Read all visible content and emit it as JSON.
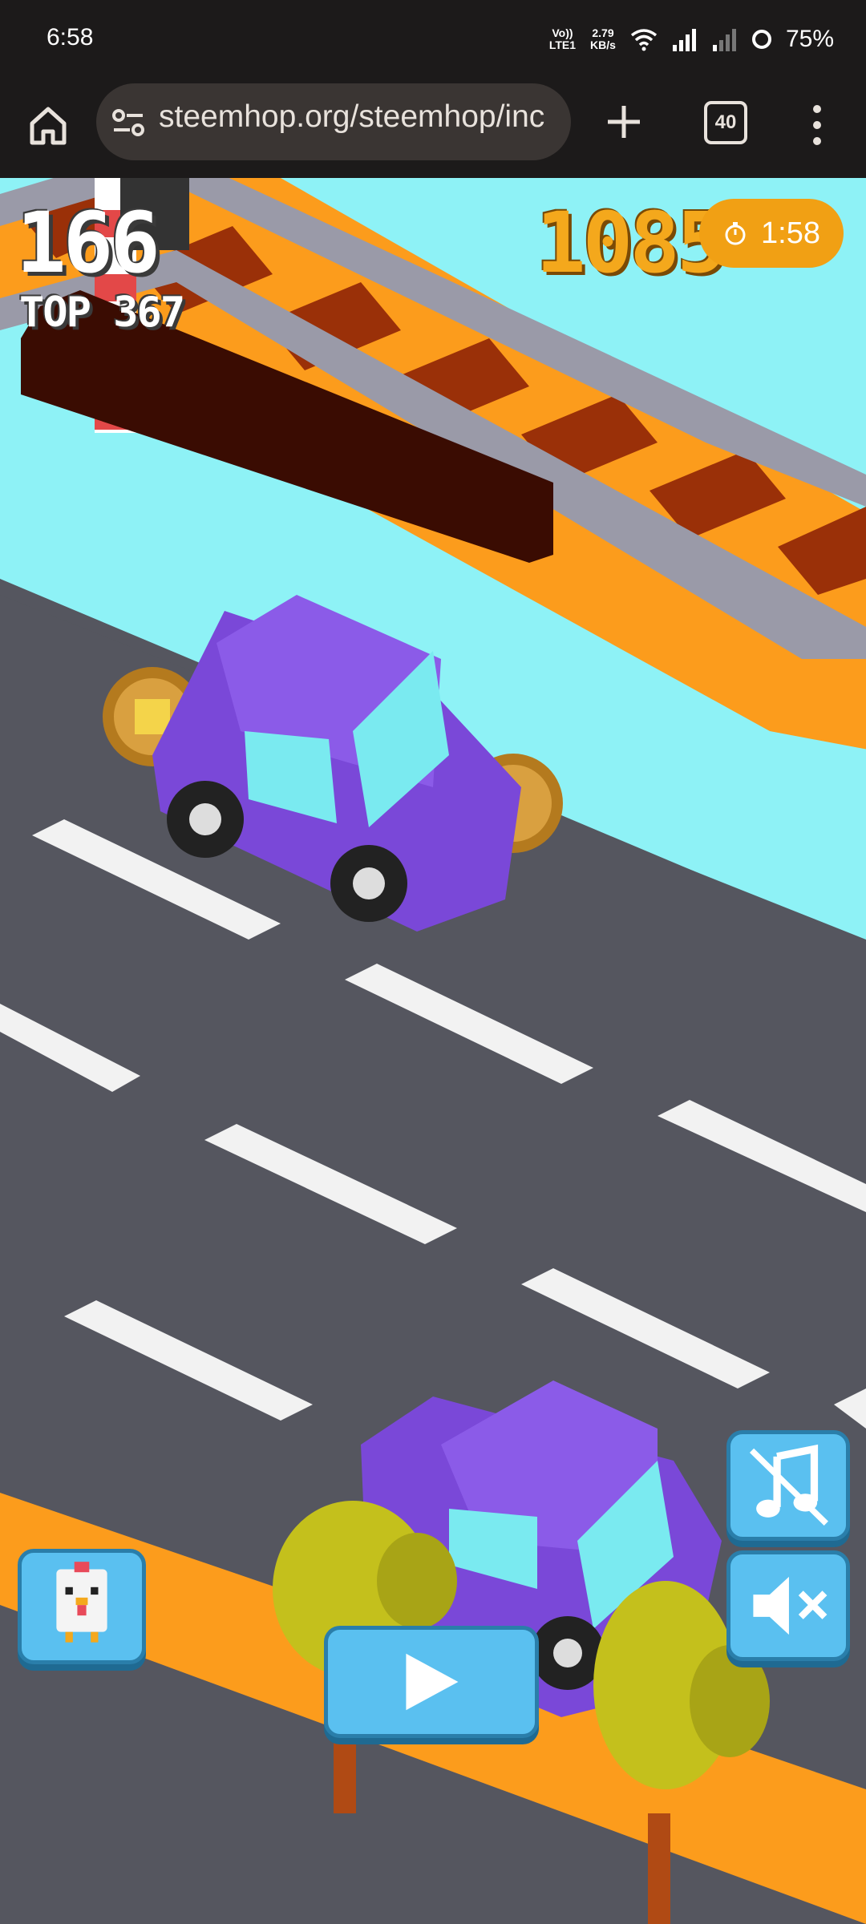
{
  "status_bar": {
    "time": "6:58",
    "volte_line1": "Vo))",
    "volte_line2": "LTE1",
    "speed_line1": "2.79",
    "speed_line2": "KB/s",
    "battery": "75%",
    "icons": [
      "wifi-icon",
      "signal-icon",
      "signal-weak-icon",
      "battery-ring-icon"
    ]
  },
  "browser": {
    "url": "steemhop.org/steemhop/inc",
    "tab_count": "40",
    "icons": [
      "home-icon",
      "site-settings-icon",
      "new-tab-plus-icon",
      "tab-switcher-icon",
      "more-menu-icon"
    ]
  },
  "game": {
    "score": "166",
    "top_score": "TOP 367",
    "coins": "1085",
    "timer": "1:58",
    "buttons": [
      "music-muted-button",
      "sound-muted-button",
      "character-select-button",
      "play-button"
    ],
    "colors": {
      "road": "#55565f",
      "water": "#8ef2f6",
      "rail": "#9a3008",
      "grass": "#fc9c1c",
      "car": "#8b5be8",
      "button": "#5ac0f0",
      "coin_text": "#f4a81c"
    }
  }
}
